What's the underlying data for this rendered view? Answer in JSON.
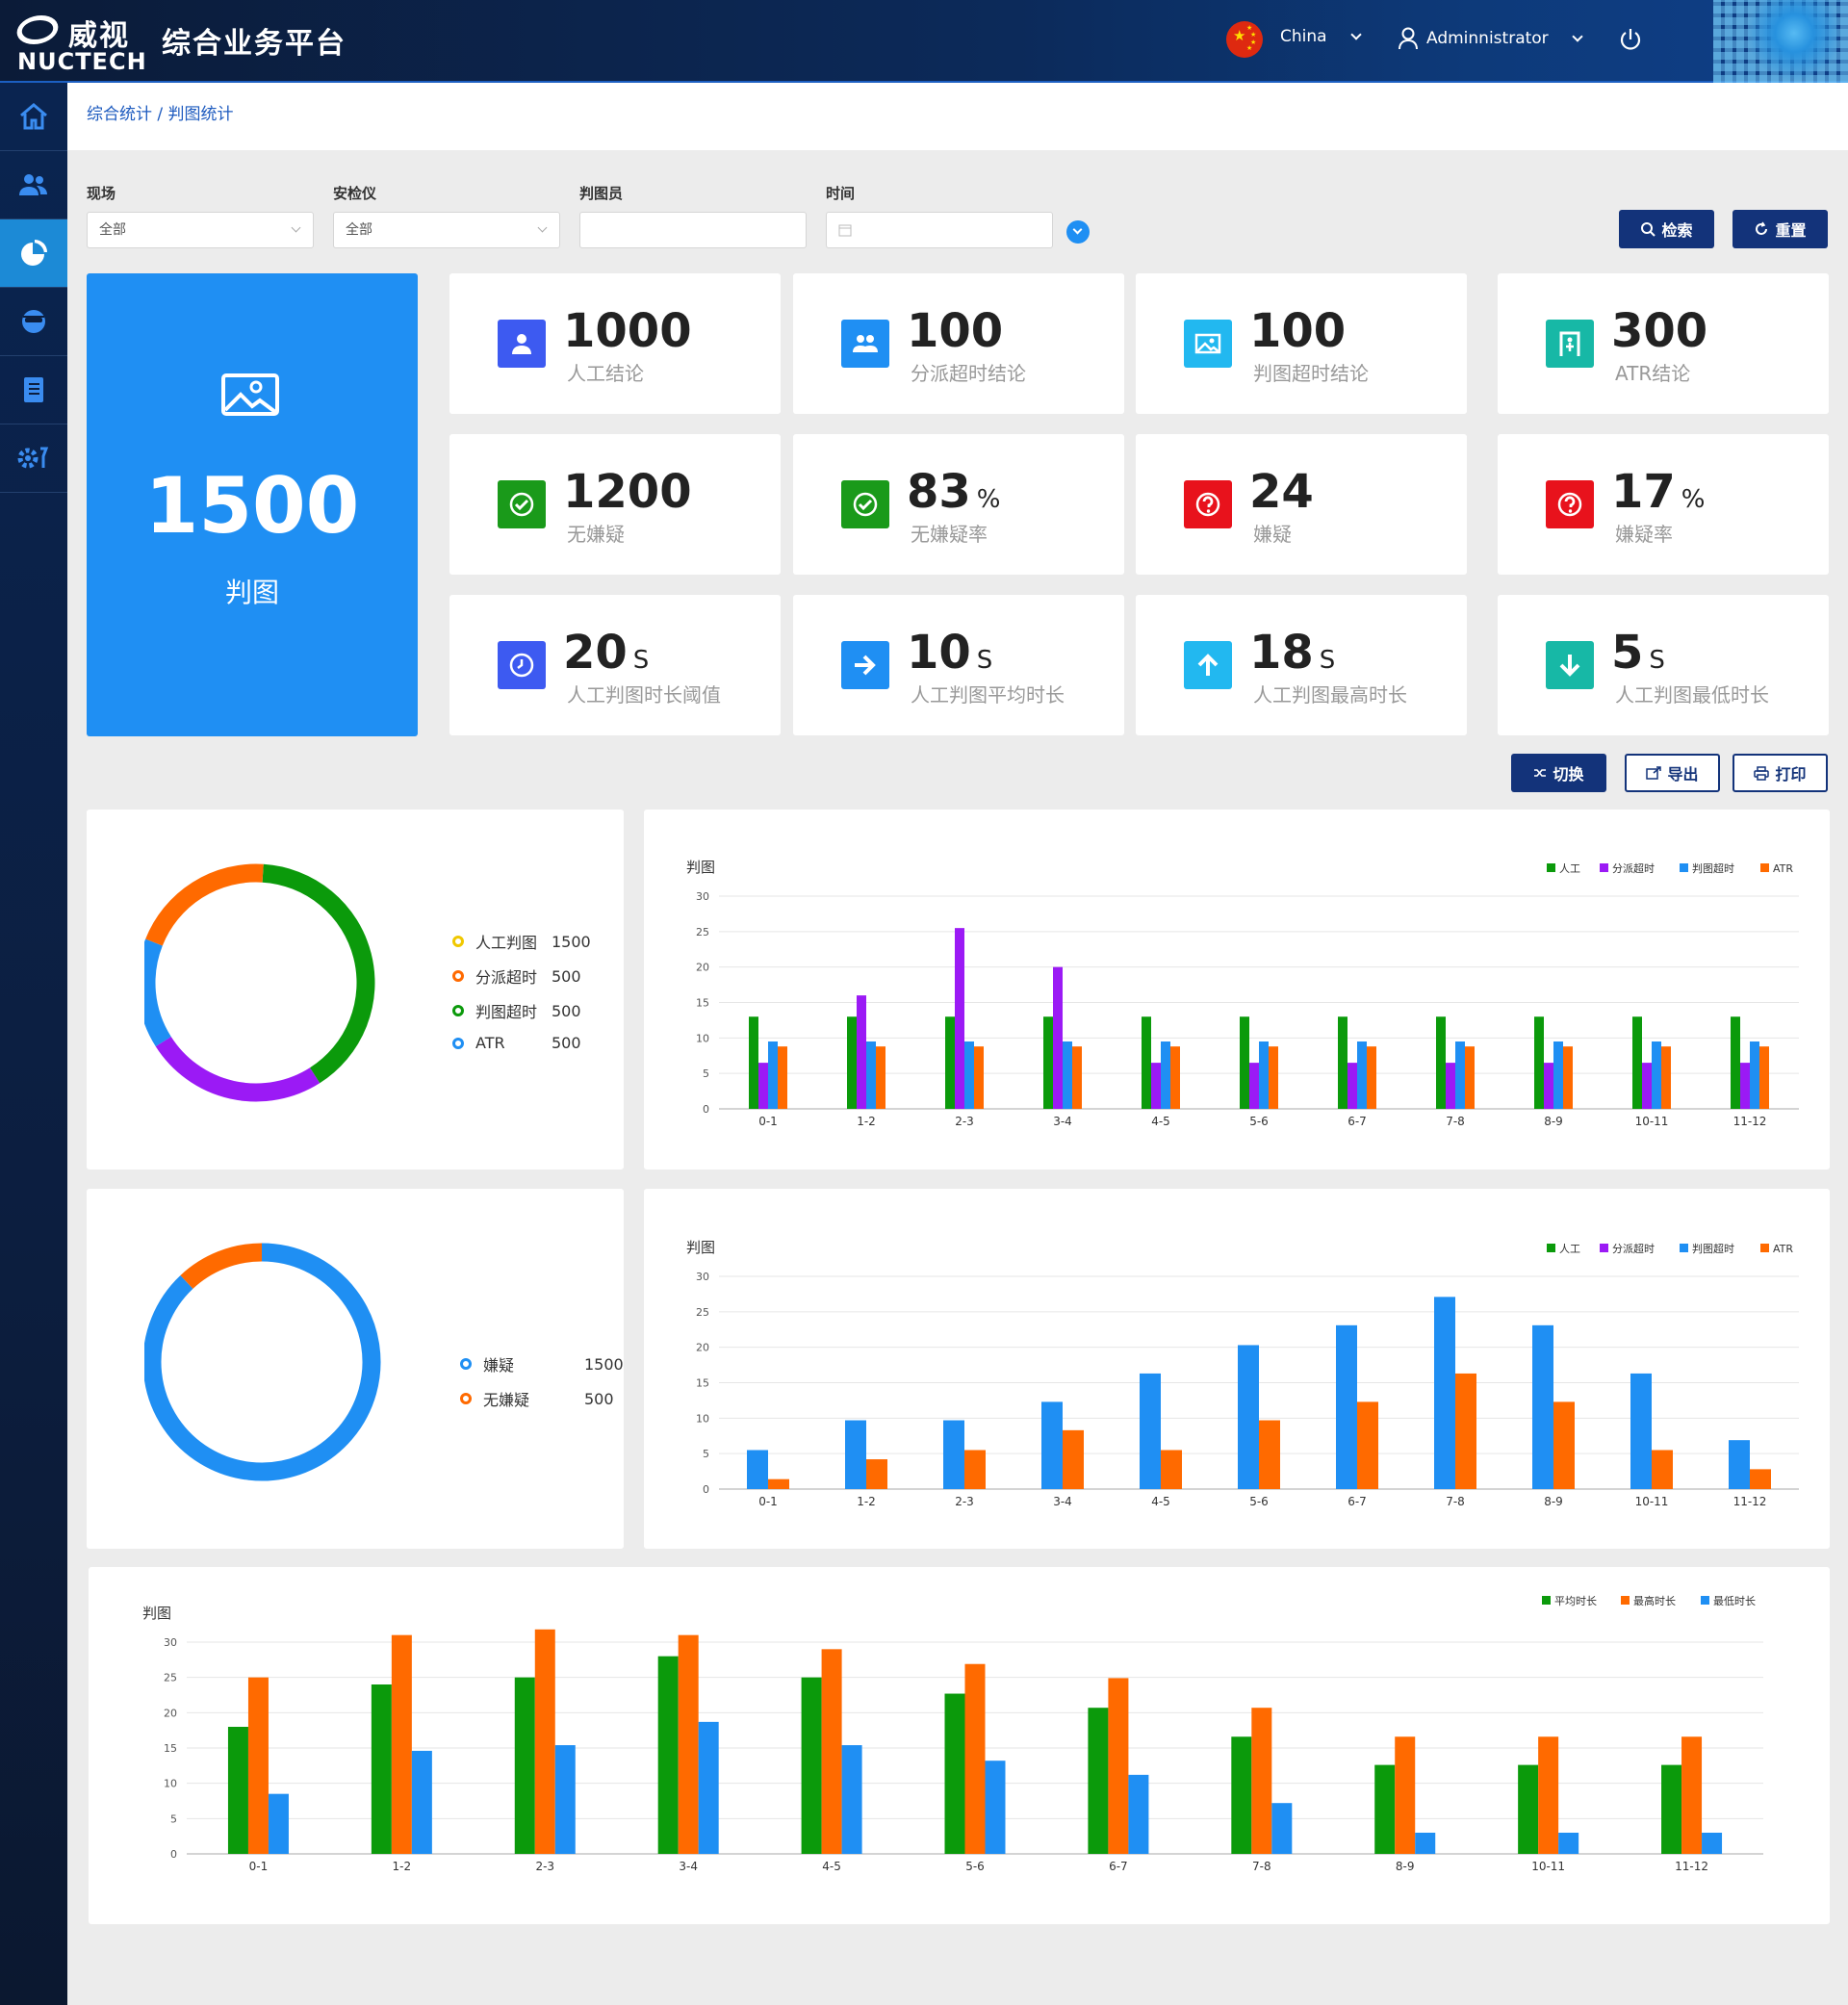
{
  "header": {
    "logo_cn": "威视",
    "logo_en": "NUCTECH",
    "title": "综合业务平台",
    "country": "China",
    "user": "Adminnistrator"
  },
  "sidebar": {
    "items": [
      {
        "icon": "home-icon"
      },
      {
        "icon": "users-icon"
      },
      {
        "icon": "pie-chart-icon",
        "active": true
      },
      {
        "icon": "inspector-icon"
      },
      {
        "icon": "book-icon"
      },
      {
        "icon": "settings-icon"
      }
    ]
  },
  "breadcrumb": {
    "parent": "综合统计",
    "sep": "/",
    "current": "判图统计"
  },
  "filters": {
    "site_label": "现场",
    "site_value": "全部",
    "device_label": "安检仪",
    "device_value": "全部",
    "operator_label": "判图员",
    "operator_value": "",
    "time_label": "时间",
    "time_value": ""
  },
  "buttons": {
    "search": "检索",
    "reset": "重置",
    "switch": "切换",
    "export": "导出",
    "print": "打印"
  },
  "summary": {
    "total": "1500",
    "total_label": "判图"
  },
  "stats": [
    {
      "value": "1000",
      "unit": "",
      "label": "人工结论",
      "color": "#3d5af1"
    },
    {
      "value": "100",
      "unit": "",
      "label": "分派超时结论",
      "color": "#1f8ff3"
    },
    {
      "value": "100",
      "unit": "",
      "label": "判图超时结论",
      "color": "#22b8f0"
    },
    {
      "value": "300",
      "unit": "",
      "label": "ATR结论",
      "color": "#17b8a6"
    },
    {
      "value": "1200",
      "unit": "",
      "label": "无嫌疑",
      "color": "#1a9a1a"
    },
    {
      "value": "83",
      "unit": "%",
      "label": "无嫌疑率",
      "color": "#1a9a1a"
    },
    {
      "value": "24",
      "unit": "",
      "label": "嫌疑",
      "color": "#e8121c"
    },
    {
      "value": "17",
      "unit": "%",
      "label": "嫌疑率",
      "color": "#e8121c"
    },
    {
      "value": "20",
      "unit": "S",
      "label": "人工判图时长阈值",
      "color": "#3d5af1"
    },
    {
      "value": "10",
      "unit": "S",
      "label": "人工判图平均时长",
      "color": "#1f8ff3"
    },
    {
      "value": "18",
      "unit": "S",
      "label": "人工判图最高时长",
      "color": "#22b8f0"
    },
    {
      "value": "5",
      "unit": "S",
      "label": "人工判图最低时长",
      "color": "#17b8a6"
    }
  ],
  "donut1": {
    "legend": [
      {
        "name": "人工判图",
        "value": "1500",
        "color": "#f0c800"
      },
      {
        "name": "分派超时",
        "value": "500",
        "color": "#ff6a00"
      },
      {
        "name": "判图超时",
        "value": "500",
        "color": "#0b9a0b"
      },
      {
        "name": "ATR",
        "value": "500",
        "color": "#1f8ff3"
      }
    ],
    "slices": [
      {
        "color": "#0b9a0b",
        "fraction": 0.4
      },
      {
        "color": "#9b1af5",
        "fraction": 0.25
      },
      {
        "color": "#1f8ff3",
        "fraction": 0.15
      },
      {
        "color": "#ff6a00",
        "fraction": 0.2
      }
    ]
  },
  "donut2": {
    "legend": [
      {
        "name": "嫌疑",
        "value": "1500",
        "color": "#1f8ff3"
      },
      {
        "name": "无嫌疑",
        "value": "500",
        "color": "#ff6a00"
      }
    ],
    "slices": [
      {
        "color": "#1f8ff3",
        "fraction": 0.88
      },
      {
        "color": "#ff6a00",
        "fraction": 0.12
      }
    ]
  },
  "chart_data": [
    {
      "type": "bar",
      "title": "判图",
      "categories": [
        "0-1",
        "1-2",
        "2-3",
        "3-4",
        "4-5",
        "5-6",
        "6-7",
        "7-8",
        "8-9",
        "10-11",
        "11-12"
      ],
      "ylim": [
        0,
        30
      ],
      "yticks": [
        0,
        5,
        10,
        15,
        20,
        25,
        30
      ],
      "legend_position": "top-right",
      "series": [
        {
          "name": "人工",
          "color": "#0b9a0b",
          "values": [
            13,
            13,
            13,
            13,
            13,
            13,
            13,
            13,
            13,
            13,
            13
          ]
        },
        {
          "name": "分派超时",
          "color": "#9b1af5",
          "values": [
            6.5,
            16,
            25.5,
            20,
            6.5,
            6.5,
            6.5,
            6.5,
            6.5,
            6.5,
            6.5
          ]
        },
        {
          "name": "判图超时",
          "color": "#1f8ff3",
          "values": [
            9.5,
            9.5,
            9.5,
            9.5,
            9.5,
            9.5,
            9.5,
            9.5,
            9.5,
            9.5,
            9.5
          ]
        },
        {
          "name": "ATR",
          "color": "#ff6a00",
          "values": [
            8.8,
            8.8,
            8.8,
            8.8,
            8.8,
            8.8,
            8.8,
            8.8,
            8.8,
            8.8,
            8.8
          ]
        }
      ]
    },
    {
      "type": "bar",
      "title": "判图",
      "categories": [
        "0-1",
        "1-2",
        "2-3",
        "3-4",
        "4-5",
        "5-6",
        "6-7",
        "7-8",
        "8-9",
        "10-11",
        "11-12"
      ],
      "ylim": [
        0,
        30
      ],
      "yticks": [
        0,
        5,
        10,
        15,
        20,
        25,
        30
      ],
      "legend_position": "top-right",
      "legend": [
        {
          "name": "人工",
          "color": "#0b9a0b"
        },
        {
          "name": "分派超时",
          "color": "#9b1af5"
        },
        {
          "name": "判图超时",
          "color": "#1f8ff3"
        },
        {
          "name": "ATR",
          "color": "#ff6a00"
        }
      ],
      "series": [
        {
          "name": "判图超时",
          "color": "#1f8ff3",
          "values": [
            5.5,
            9.7,
            9.7,
            12.3,
            16.3,
            20.3,
            23.1,
            27.1,
            23.1,
            16.3,
            6.9
          ]
        },
        {
          "name": "ATR",
          "color": "#ff6a00",
          "values": [
            1.4,
            4.2,
            5.5,
            8.3,
            5.5,
            9.7,
            12.3,
            16.3,
            12.3,
            5.5,
            2.8
          ]
        }
      ]
    },
    {
      "type": "bar",
      "title": "判图",
      "categories": [
        "0-1",
        "1-2",
        "2-3",
        "3-4",
        "4-5",
        "5-6",
        "6-7",
        "7-8",
        "8-9",
        "10-11",
        "11-12"
      ],
      "ylim": [
        0,
        30
      ],
      "yticks": [
        0,
        5,
        10,
        15,
        20,
        25,
        30
      ],
      "legend_position": "top-right",
      "series": [
        {
          "name": "平均时长",
          "color": "#0b9a0b",
          "values": [
            18,
            24,
            25,
            28,
            25,
            22.7,
            20.7,
            16.6,
            12.6,
            12.6,
            12.6
          ]
        },
        {
          "name": "最高时长",
          "color": "#ff6a00",
          "values": [
            25,
            31,
            31.8,
            31,
            29,
            26.9,
            24.9,
            20.7,
            16.6,
            16.6,
            16.6
          ]
        },
        {
          "name": "最低时长",
          "color": "#1f8ff3",
          "values": [
            8.5,
            14.6,
            15.4,
            18.7,
            15.4,
            13.2,
            11.2,
            7.2,
            3,
            3,
            3
          ]
        }
      ]
    }
  ]
}
